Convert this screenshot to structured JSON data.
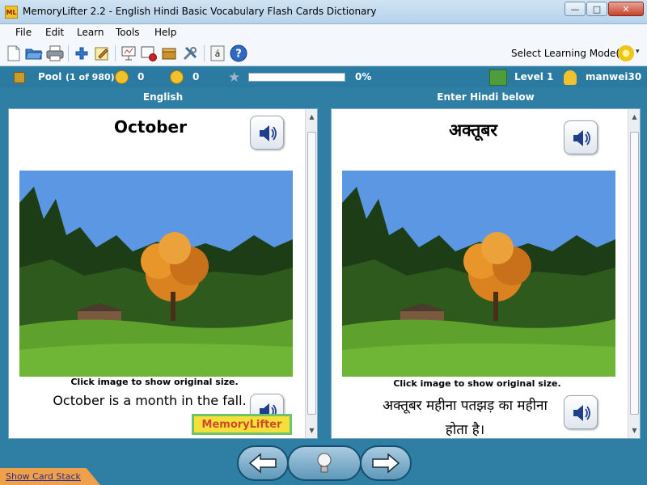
{
  "window": {
    "app_icon_text": "ML",
    "title": "MemoryLifter 2.2 - English Hindi Basic Vocabulary Flash Cards Dictionary",
    "minimize": "—",
    "maximize": "□",
    "close": "✕"
  },
  "menu": {
    "items": [
      "File",
      "Edit",
      "Learn",
      "Tools",
      "Help"
    ]
  },
  "toolbar": {
    "icons": [
      "new-document-icon",
      "open-folder-icon",
      "print-icon",
      "add-card-icon",
      "edit-card-icon",
      "presentation-icon",
      "slideshow-icon",
      "box-icon",
      "settings-tools-icon",
      "special-chars-icon",
      "help-icon"
    ],
    "learning_mode_label": "Select Learning Mode(s)",
    "learning_mode_arrow": "▾"
  },
  "status": {
    "pool_label": "Pool",
    "pool_count": "(1 of 980)",
    "correct_count": "0",
    "wrong_count": "0",
    "progress_percent": 0,
    "progress_text": "0%",
    "level": "Level 1",
    "username": "manwei30"
  },
  "columns": {
    "left_header": "English",
    "right_header": "Enter Hindi below"
  },
  "card_left": {
    "word": "October",
    "image_caption": "Click image to show original size.",
    "sentence": "October is a month in the fall.",
    "logo_text": "MemoryLifter"
  },
  "card_right": {
    "word": "अक्तूबर",
    "image_caption": "Click image to show original size.",
    "sentence": "अक्तूबर महीना पतझड़ का महीना होता है।"
  },
  "bottom": {
    "show_card_stack": "Show Card Stack"
  },
  "colors": {
    "background": "#2f7ea3",
    "status_bar": "#2a7aa1",
    "progress_fill": "#3aa14b"
  }
}
